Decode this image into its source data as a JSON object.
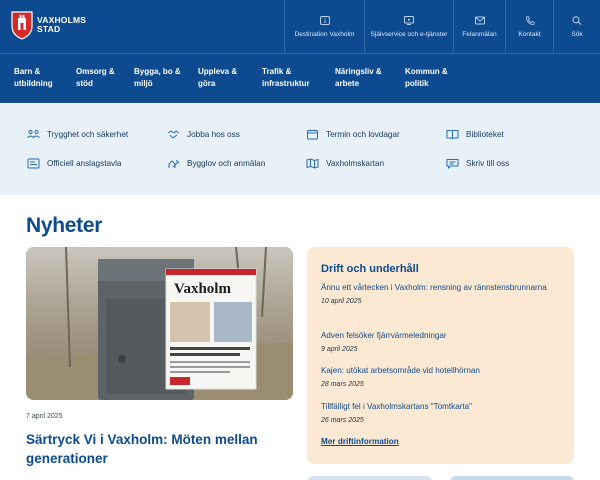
{
  "header": {
    "logo": {
      "line1": "VAXHOLMS",
      "line2": "STAD"
    },
    "top_links": [
      {
        "label": "Destination Vaxholm",
        "icon": "info-icon"
      },
      {
        "label": "Självservice och e-tjänster",
        "icon": "monitor-icon"
      },
      {
        "label": "Felanmälan",
        "icon": "mail-icon"
      },
      {
        "label": "Kontakt",
        "icon": "phone-icon"
      },
      {
        "label": "Sök",
        "icon": "search-icon"
      }
    ]
  },
  "main_nav": [
    {
      "line1": "Barn &",
      "line2": "utbildning"
    },
    {
      "line1": "Omsorg &",
      "line2": "stöd"
    },
    {
      "line1": "Bygga, bo &",
      "line2": "miljö"
    },
    {
      "line1": "Uppleva &",
      "line2": "göra"
    },
    {
      "line1": "Trafik &",
      "line2": "infrastruktur"
    },
    {
      "line1": "Näringsliv &",
      "line2": "arbete"
    },
    {
      "line1": "Kommun &",
      "line2": "politik"
    }
  ],
  "quick_links": [
    {
      "label": "Trygghet och säkerhet",
      "icon": "people-icon"
    },
    {
      "label": "Jobba hos oss",
      "icon": "handshake-icon"
    },
    {
      "label": "Termin och lovdagar",
      "icon": "calendar-icon"
    },
    {
      "label": "Biblioteket",
      "icon": "book-icon"
    },
    {
      "label": "Officiell anslagstavla",
      "icon": "noticeboard-icon"
    },
    {
      "label": "Bygglov och anmälan",
      "icon": "building-permit-icon"
    },
    {
      "label": "Vaxholmskartan",
      "icon": "map-icon"
    },
    {
      "label": "Skriv till oss",
      "icon": "write-icon"
    }
  ],
  "news": {
    "heading": "Nyheter",
    "featured": {
      "date": "7 april 2025",
      "headline": "Särtryck Vi i Vaxholm: Möten mellan generationer",
      "paper_masthead": "Vaxholm"
    }
  },
  "drift": {
    "title": "Drift och underhåll",
    "items": [
      {
        "title": "Ännu ett vårtecken i Vaxholm: rensning av rännstensbrunnarna",
        "date": "10 april 2025"
      },
      {
        "title": "Adven felsöker fjärrvärmeledningar",
        "date": "9 april 2025"
      },
      {
        "title": "Kajen: utökat arbetsområde vid hotellhörnan",
        "date": "28 mars 2025"
      },
      {
        "title": "Tillfälligt fel i Vaxholmskartans \"Tomtkarta\"",
        "date": "26 mars 2025"
      }
    ],
    "more_link": "Mer driftinformation"
  },
  "colors": {
    "primary": "#0d4a8f",
    "quick_bg": "#e8f0f8",
    "drift_bg": "#fbe9d3"
  }
}
